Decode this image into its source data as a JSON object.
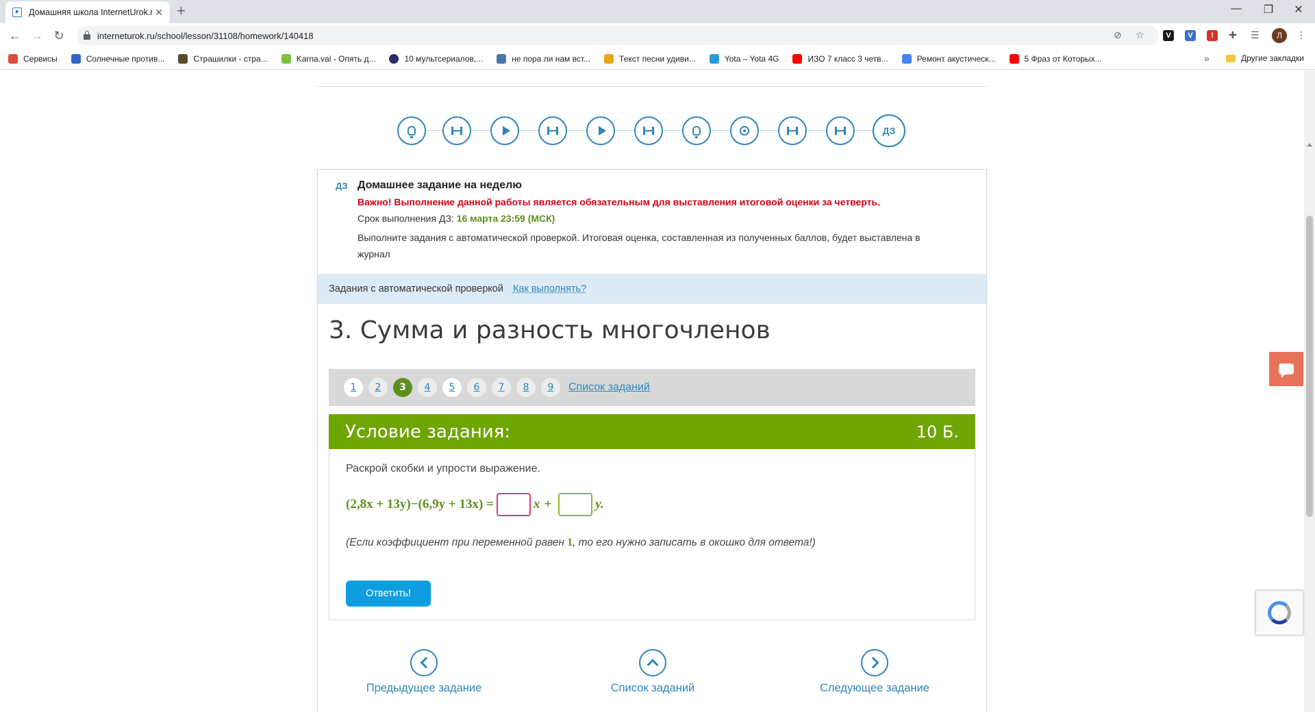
{
  "browser": {
    "tab_title": "Домашняя школа InternetUrok.ru",
    "url": "interneturok.ru/school/lesson/31108/homework/140418",
    "profile_letter": "Л",
    "bookmarks": [
      {
        "label": "Сервисы",
        "color": "#e04a3c"
      },
      {
        "label": "Солнечные против...",
        "color": "#3366cc"
      },
      {
        "label": "Страшилки - стра...",
        "color": "#5a4a2a"
      },
      {
        "label": "Karna.val - Опять д...",
        "color": "#7dc142"
      },
      {
        "label": "10 мультсериалов,...",
        "color": "#2d2d6a"
      },
      {
        "label": "не пора ли нам вст...",
        "color": "#4a76a8"
      },
      {
        "label": "Текст песни удиви...",
        "color": "#e6a817"
      },
      {
        "label": "Yota – Yota 4G",
        "color": "#2b9bd7"
      },
      {
        "label": "ИЗО 7 класс 3 четв...",
        "color": "#ff0000"
      },
      {
        "label": "Ремонт акустическ...",
        "color": "#4285f4"
      },
      {
        "label": "5 Фраз от Которых...",
        "color": "#ff0000"
      }
    ],
    "more_bookmarks": "»",
    "other_bookmarks": "Другие закладки"
  },
  "lesson_nav": {
    "steps": [
      "bulb",
      "dumbbell",
      "play",
      "dumbbell",
      "play",
      "dumbbell",
      "bulb",
      "cam",
      "dumbbell",
      "dumbbell",
      "ДЗ"
    ]
  },
  "homework": {
    "tag": "ДЗ",
    "title": "Домашнее задание на неделю",
    "important": "Важно! Выполнение данной работы является обязательным для выставления итоговой оценки за четверть.",
    "deadline_label": "Срок выполнения ДЗ: ",
    "deadline_value": "16 марта 23:59 (МСК)",
    "description": "Выполните задания с автоматической проверкой. Итоговая оценка, составленная из полученных баллов, будет выставлена в журнал"
  },
  "auto_check": {
    "label": "Задания с автоматической проверкой",
    "how_link": "Как выполнять?"
  },
  "task": {
    "title": "3. Сумма и разность многочленов",
    "pages": [
      "1",
      "2",
      "3",
      "4",
      "5",
      "6",
      "7",
      "8",
      "9"
    ],
    "active_page": "3",
    "list_link": "Список заданий",
    "condition_label": "Условие задания:",
    "score": "10 Б.",
    "instruction": "Раскрой скобки и упрости выражение.",
    "expression_left": "(2,8x + 13y)−(6,9y + 13x) =",
    "var_x": "x",
    "plus": "+",
    "var_y": "y.",
    "answer_x": "",
    "answer_y": "",
    "note_before": "(Если коэффициент при переменной равен ",
    "note_one": "1",
    "note_after": ", то его нужно записать в окошко для ответа!)",
    "answer_button": "Ответить!"
  },
  "bottom_nav": {
    "prev": "Предыдущее задание",
    "list": "Список заданий",
    "next": "Следующее задание"
  }
}
